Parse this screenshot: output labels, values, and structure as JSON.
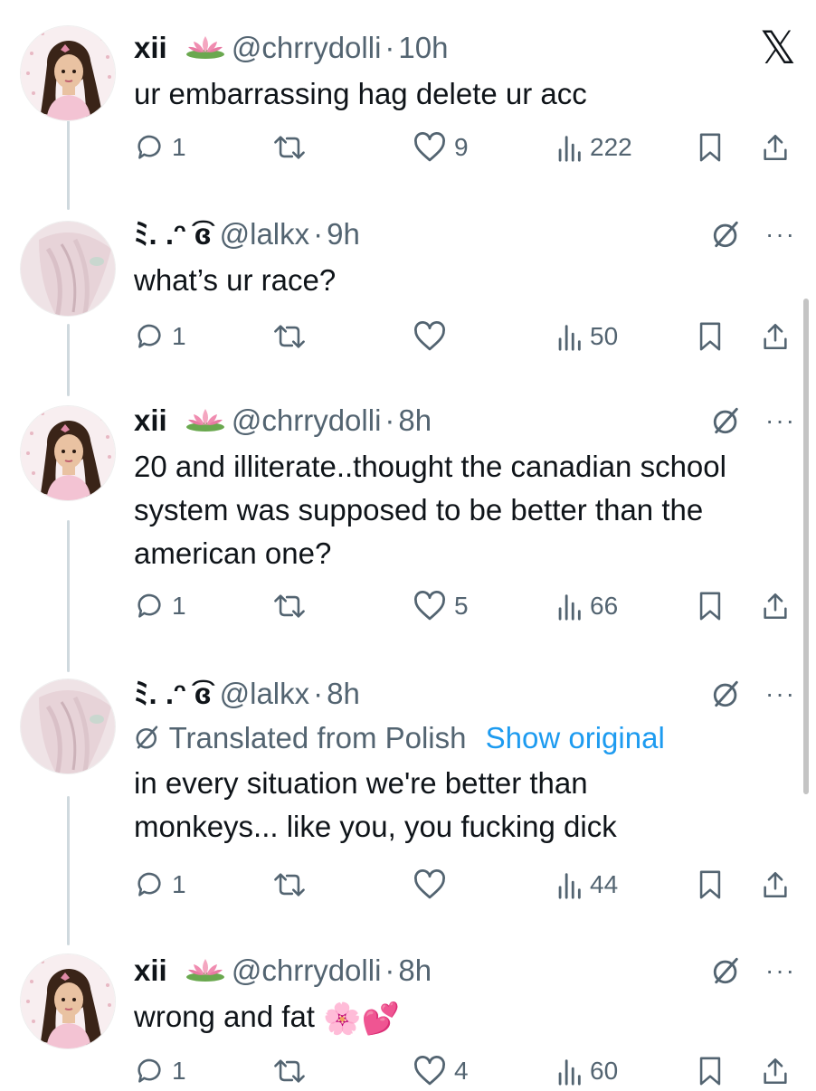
{
  "tweets": [
    {
      "name": "xii",
      "flag": "lotus-icon",
      "handle": "@chrrydolli",
      "time": "10h",
      "text": "ur embarrassing hag delete ur acc",
      "stats": {
        "replies": "1",
        "likes": "9",
        "views": "222"
      },
      "top_right": "x-logo"
    },
    {
      "name": "ﾐ. .ᵔ ͡ɞ",
      "handle": "@lalkx",
      "time": "9h",
      "text": "what’s ur race?",
      "stats": {
        "replies": "1",
        "likes": "",
        "views": "50"
      },
      "top_right": "grok-more"
    },
    {
      "name": "xii",
      "flag": "lotus-icon",
      "handle": "@chrrydolli",
      "time": "8h",
      "text": "20 and illiterate..thought the canadian school system was supposed to be better than the american one?",
      "stats": {
        "replies": "1",
        "likes": "5",
        "views": "66"
      },
      "top_right": "grok-more"
    },
    {
      "name": "ﾐ. .ᵔ ͡ɞ",
      "handle": "@lalkx",
      "time": "8h",
      "translated_label": "Translated from Polish",
      "show_original": "Show original",
      "text": "in every situation we're better than monkeys... like you, you fucking dick",
      "stats": {
        "replies": "1",
        "likes": "",
        "views": "44"
      },
      "top_right": "grok-more"
    },
    {
      "name": "xii",
      "flag": "lotus-icon",
      "handle": "@chrrydolli",
      "time": "8h",
      "text": "wrong and fat",
      "text_emoji": "🌸💕",
      "stats": {
        "replies": "1",
        "likes": "4",
        "views": "60"
      },
      "top_right": "grok-more"
    }
  ],
  "separator": "·",
  "more_glyph": "···",
  "x_glyph": "𝕏"
}
